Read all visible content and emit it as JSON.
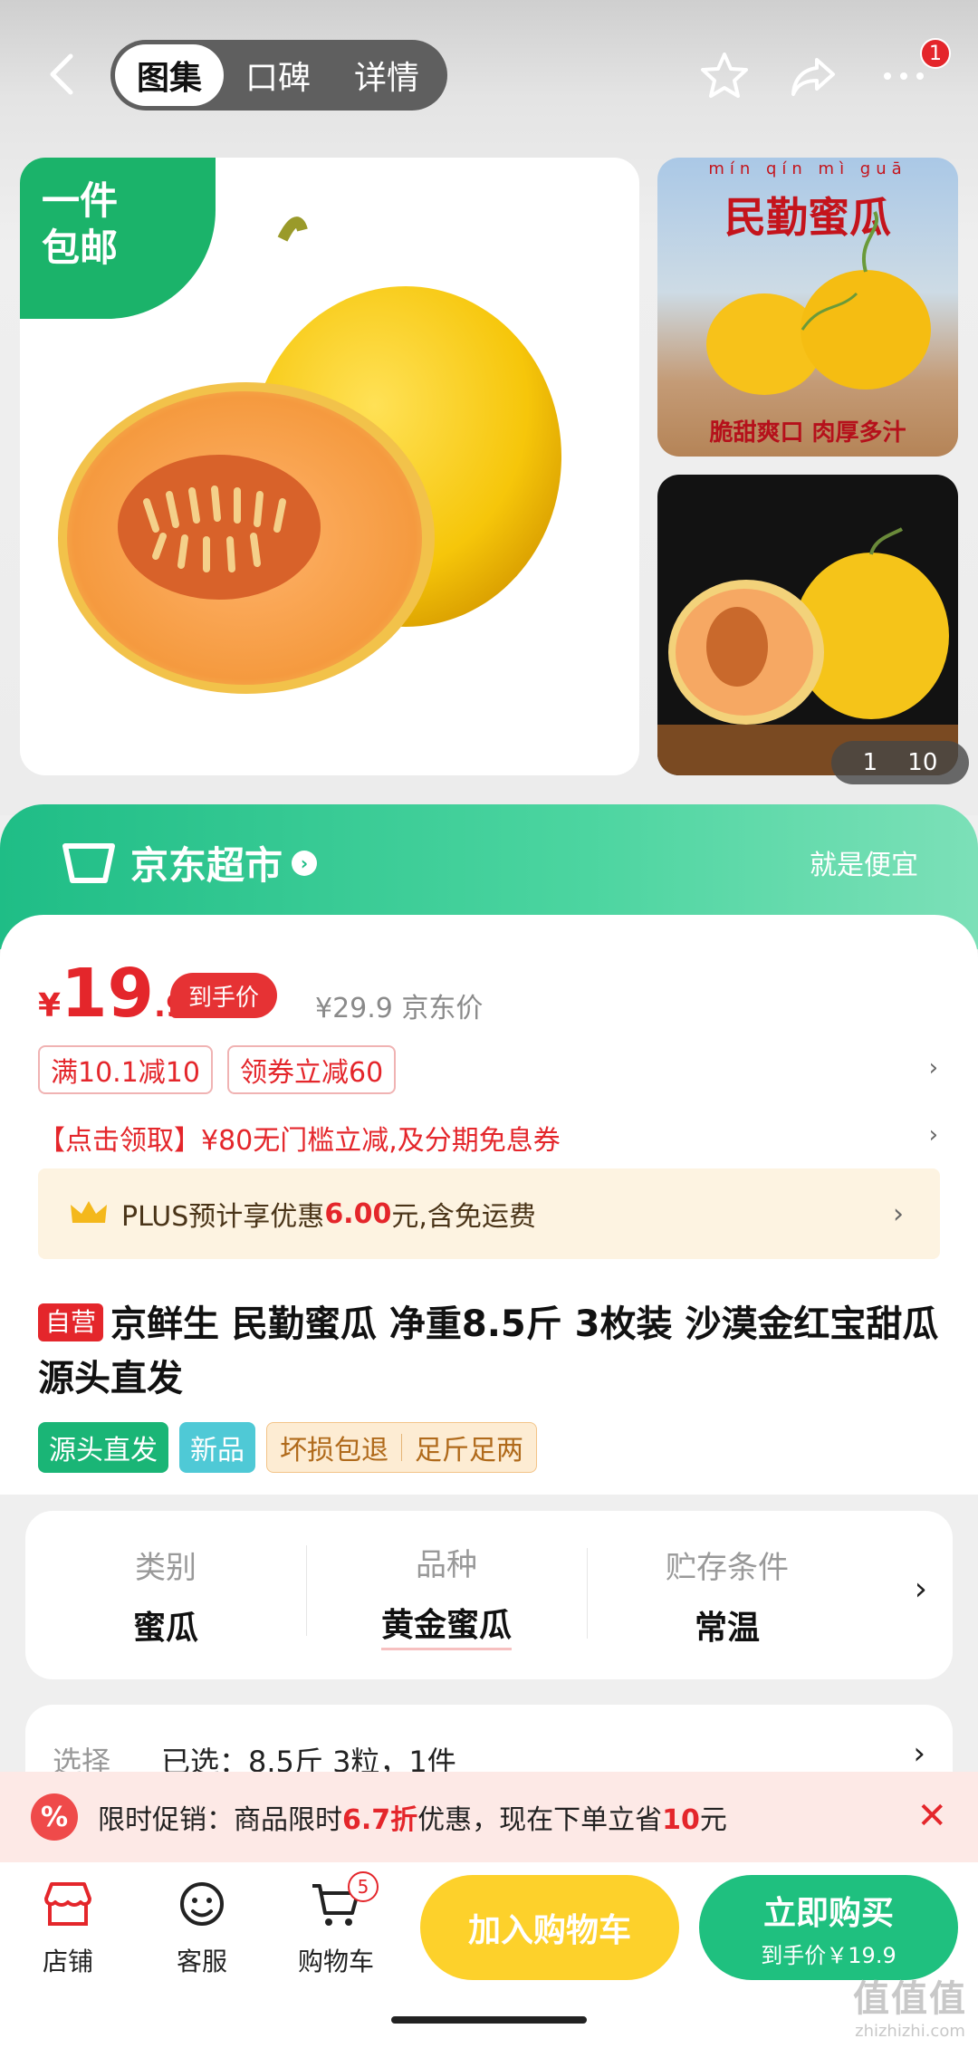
{
  "header": {
    "tabs": [
      "图集",
      "口碑",
      "详情"
    ],
    "active_tab": "图集",
    "notification_count": "1"
  },
  "gallery": {
    "shipping_tag_line1": "一件",
    "shipping_tag_line2": "包邮",
    "side1_pinyin": "mín qín mì guā",
    "side1_title": "民勤蜜瓜",
    "side1_caption": "脆甜爽口 肉厚多汁",
    "counter_current": "1",
    "counter_total": "10"
  },
  "store": {
    "name": "京东超市",
    "slogan": "就是便宜"
  },
  "price": {
    "symbol": "¥",
    "integer": "19",
    "decimal": ".9",
    "hand_price_label": "到手价",
    "original": "¥29.9 京东价"
  },
  "coupons": [
    "满10.1减10",
    "领券立减60"
  ],
  "claim_text": "【点击领取】¥80无门槛立减,及分期免息券",
  "plus": {
    "prefix": "PLUS预计享优惠",
    "amount": "6.00",
    "suffix": "元,含免运费"
  },
  "product": {
    "self_tag": "自营",
    "title": "京鲜生 民勤蜜瓜 净重8.5斤 3枚装 沙漠金红宝甜瓜 源头直发"
  },
  "tags": {
    "tag1": "源头直发",
    "tag2": "新品",
    "tag3a": "坏损包退",
    "tag3b": "足斤足两"
  },
  "specs": [
    {
      "label": "类别",
      "value": "蜜瓜"
    },
    {
      "label": "品种",
      "value": "黄金蜜瓜"
    },
    {
      "label": "贮存条件",
      "value": "常温"
    }
  ],
  "selection": {
    "label": "选择",
    "value": "已选：8.5斤 3粒，1件"
  },
  "promo": {
    "icon_text": "%",
    "prefix": "限时促销：商品限时",
    "discount": "6.7折",
    "middle": "优惠，现在下单立省",
    "saving": "10",
    "suffix": "元"
  },
  "bottom_nav": {
    "shop": "店铺",
    "service": "客服",
    "cart": "购物车",
    "cart_count": "5",
    "add_to_cart": "加入购物车",
    "buy_now": "立即购买",
    "buy_now_sub": "到手价￥19.9"
  },
  "watermark": {
    "line1": "值值值",
    "line2": "zhizhizhi.com"
  },
  "colors": {
    "brand_red": "#e4262b",
    "store_green": "#1fbd86",
    "add_cart_yellow": "#fdd12b",
    "buy_green": "#1fc07f"
  }
}
